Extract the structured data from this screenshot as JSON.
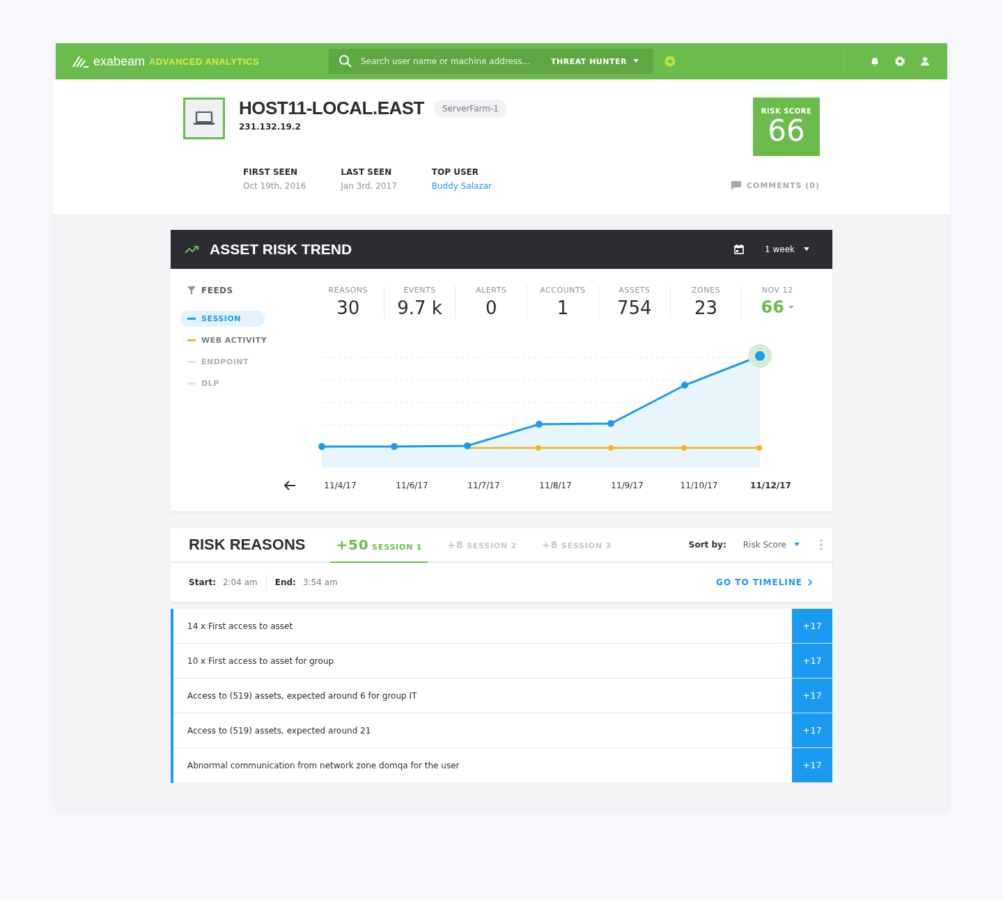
{
  "topbar": {
    "logo": "exabeam",
    "product": "ADVANCED ANALYTICS",
    "search": {
      "placeholder": "Search user name or machine address…"
    },
    "mode": "THREAT HUNTER"
  },
  "asset": {
    "name": "HOST11-LOCAL.EAST",
    "tag": "ServerFarm-1",
    "ip": "231.132.19.2",
    "facts": [
      {
        "label": "FIRST SEEN",
        "value": "Oct 19th, 2016",
        "kind": "text"
      },
      {
        "label": "LAST SEEN",
        "value": "Jan 3rd, 2017",
        "kind": "text"
      },
      {
        "label": "TOP USER",
        "value": "Buddy Salazar",
        "kind": "link"
      }
    ],
    "risk_label": "RISK SCORE",
    "risk_score": "66",
    "comments": "COMMENTS (0)"
  },
  "trend": {
    "title": "ASSET RISK TREND",
    "range": "1 week",
    "feeds_title": "FEEDS",
    "feeds": [
      {
        "label": "SESSION",
        "color": "#1a9af0",
        "selected": true,
        "disabled": false
      },
      {
        "label": "WEB ACTIVITY",
        "color": "#f5b31b",
        "selected": false,
        "disabled": false
      },
      {
        "label": "ENDPOINT",
        "color": "#dfe2e6",
        "selected": false,
        "disabled": true
      },
      {
        "label": "DLP",
        "color": "#dfe2e6",
        "selected": false,
        "disabled": true
      }
    ],
    "stats": [
      {
        "label": "REASONS",
        "value": "30",
        "kind": "plain"
      },
      {
        "label": "EVENTS",
        "value": "9.7 k",
        "kind": "plain"
      },
      {
        "label": "ALERTS",
        "value": "0",
        "kind": "plain"
      },
      {
        "label": "ACCOUNTS",
        "value": "1",
        "kind": "plain"
      },
      {
        "label": "ASSETS",
        "value": "754",
        "kind": "plain"
      },
      {
        "label": "ZONES",
        "value": "23",
        "kind": "plain"
      },
      {
        "label": "NOV 12",
        "value": "66",
        "kind": "score"
      }
    ],
    "dates": [
      {
        "label": "11/4/17",
        "selected": false
      },
      {
        "label": "11/6/17",
        "selected": false
      },
      {
        "label": "11/7/17",
        "selected": false
      },
      {
        "label": "11/8/17",
        "selected": false
      },
      {
        "label": "11/9/17",
        "selected": false
      },
      {
        "label": "11/10/17",
        "selected": false
      },
      {
        "label": "11/12/17",
        "selected": true
      }
    ]
  },
  "reasons": {
    "title": "RISK REASONS",
    "tabs": [
      {
        "score": "+50",
        "label": "SESSION 1",
        "selected": true
      },
      {
        "score": "+8",
        "label": "SESSION 2",
        "selected": false
      },
      {
        "score": "+8",
        "label": "SESSION 3",
        "selected": false
      }
    ],
    "sort_label": "Sort by:",
    "sort_value": "Risk Score",
    "start_label": "Start:",
    "start": "2:04 am",
    "end_label": "End:",
    "end": "3:54 am",
    "timeline": "GO TO TIMELINE",
    "rows": [
      {
        "text": "14 x First access to asset",
        "score": "+17"
      },
      {
        "text": "10 x First access to asset for group",
        "score": "+17"
      },
      {
        "text": "Access to (519) assets, expected around 6 for group IT",
        "score": "+17"
      },
      {
        "text": "Access to (519) assets, expected around 21",
        "score": "+17"
      },
      {
        "text": "Abnormal communication from network zone domqa for the user",
        "score": "+17"
      }
    ]
  }
}
